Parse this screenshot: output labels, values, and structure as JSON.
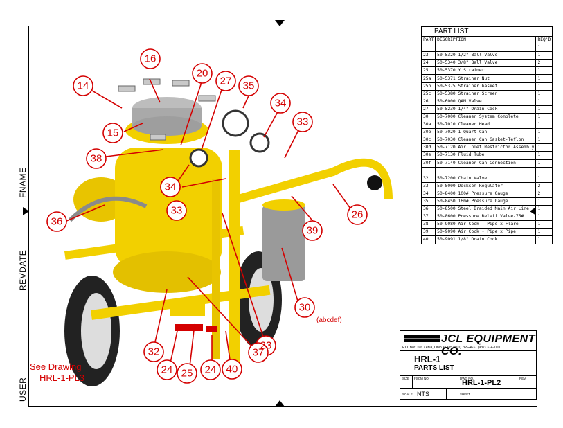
{
  "side_labels": {
    "fname": "FNAME",
    "revdate": "REVDATE",
    "user": "USER"
  },
  "callouts": [
    "14",
    "16",
    "20",
    "27",
    "35",
    "34",
    "33",
    "15",
    "38",
    "34",
    "33",
    "36",
    "26",
    "39",
    "30",
    "32",
    "24",
    "25",
    "24",
    "40",
    "37",
    "23"
  ],
  "callout_30_suffix": "(abcdef)",
  "see_drawing": {
    "line1": "See Drawing",
    "line2": "HRL-1-PL3"
  },
  "parts_list": {
    "title": "PART LIST",
    "headers": [
      "PART",
      "DESCRIPTION",
      "REQ'D"
    ],
    "rows": [
      [
        "",
        "",
        "1"
      ],
      [
        "23",
        "50-5320  1/2\" Ball Valve",
        "1"
      ],
      [
        "24",
        "50-5340  3/8\" Ball Valve",
        "2"
      ],
      [
        "25",
        "50-5370  Y Strainer",
        "1"
      ],
      [
        "25a",
        "50-5371  Strainer Nut",
        "1"
      ],
      [
        "25b",
        "50-5375  Strainer Gasket",
        "1"
      ],
      [
        "25c",
        "50-5380  Strainer Screen",
        "1"
      ],
      [
        "26",
        "50-6000  QAM Valve",
        "1"
      ],
      [
        "27",
        "50-5230  1/4\" Drain Cock",
        "1"
      ],
      [
        "30",
        "50-7000  Cleaner System Complete",
        "1"
      ],
      [
        "30a",
        "50-7010  Cleaner Head",
        "1"
      ],
      [
        "30b",
        "50-7020  1 Quart Can",
        "1"
      ],
      [
        "30c",
        "50-7030  Cleaner Can Gasket-Teflon",
        "1"
      ],
      [
        "30d",
        "50-7120  Air Inlet Restrictor Assembly",
        "1"
      ],
      [
        "30e",
        "50-7130  Fluid Tube",
        "1"
      ],
      [
        "30f",
        "50-7140  Cleaner Can Connection",
        "1"
      ],
      [
        "",
        "",
        ""
      ],
      [
        "32",
        "50-7200  Chain Valve",
        "1"
      ],
      [
        "33",
        "50-8000  Dockson Regulator",
        "2"
      ],
      [
        "34",
        "50-8400  100# Pressure Gauge",
        "2"
      ],
      [
        "35",
        "50-8450  160# Pressure Gauge",
        "1"
      ],
      [
        "36",
        "50-8500  Steel Braided Main Air Line",
        "1"
      ],
      [
        "37",
        "50-8600  Pressure Releif Valve-75#",
        "1"
      ],
      [
        "38",
        "50-9080  Air Cock - Pipe x Flare",
        "1"
      ],
      [
        "39",
        "50-9090  Air Cock - Pipe x Pipe",
        "1"
      ],
      [
        "40",
        "50-9091  1/8\" Drain Cock",
        "1"
      ]
    ]
  },
  "title_block": {
    "company": "JCL EQUIPMENT CO.",
    "address": "P.O. Box 396 Xenia, Ohio 45385    (800) 765-4637  (937) 374-1010",
    "model": "HRL-1",
    "subtitle": "PARTS LIST",
    "size_label": "SIZE",
    "fscm_label": "FSCM NO.",
    "dwg_label": "DWG NO.",
    "rev_label": "REV",
    "dwg_no": "HRL-1-PL2",
    "scale_label": "SCALE",
    "scale_value": "NTS",
    "sheet_label": "SHEET"
  },
  "colors": {
    "callout": "#d40000",
    "machine": "#f2d000",
    "hose": "#c8b000"
  }
}
